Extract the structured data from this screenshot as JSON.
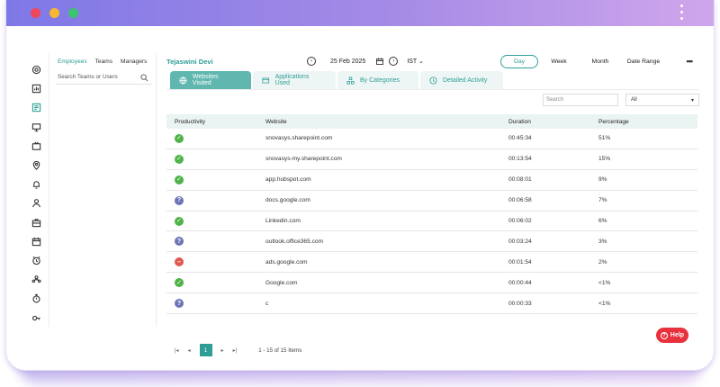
{
  "leftpanel": {
    "tabs": [
      "Employees",
      "Teams",
      "Managers"
    ],
    "search_placeholder": "Search Teams or Users"
  },
  "header": {
    "employee_name": "Tejaswini Devi",
    "date": "25 Feb 2025",
    "timezone": "IST",
    "range_tabs": [
      "Day",
      "Week",
      "Month",
      "Date Range"
    ],
    "more": "•••"
  },
  "tabs": [
    "Websites Visited",
    "Applications Used",
    "By Categories",
    "Detailed Activity"
  ],
  "filters": {
    "search_placeholder": "Search",
    "select_value": "All"
  },
  "table": {
    "headers": [
      "Productivity",
      "Website",
      "Duration",
      "Percentage"
    ],
    "rows": [
      {
        "status": "productive",
        "website": "snovasys.sharepoint.com",
        "duration": "00:45:34",
        "percentage": "51%"
      },
      {
        "status": "productive",
        "website": "snovasys-my.sharepoint.com",
        "duration": "00:13:54",
        "percentage": "15%"
      },
      {
        "status": "productive",
        "website": "app.hubspot.com",
        "duration": "00:08:01",
        "percentage": "9%"
      },
      {
        "status": "neutral",
        "website": "docs.google.com",
        "duration": "00:06:58",
        "percentage": "7%"
      },
      {
        "status": "productive",
        "website": "Linkedin.com",
        "duration": "00:06:02",
        "percentage": "6%"
      },
      {
        "status": "neutral",
        "website": "outlook.office365.com",
        "duration": "00:03:24",
        "percentage": "3%"
      },
      {
        "status": "unproductive",
        "website": "ads.google.com",
        "duration": "00:01:54",
        "percentage": "2%"
      },
      {
        "status": "productive",
        "website": "Google.com",
        "duration": "00:00:44",
        "percentage": "<1%"
      },
      {
        "status": "neutral",
        "website": "c",
        "duration": "00:00:33",
        "percentage": "<1%"
      }
    ]
  },
  "pager": {
    "current_page": "1",
    "info": "1 - 15 of 15 Items"
  },
  "help_label": "Help",
  "colors": {
    "accent": "#2d9d95",
    "productive": "#4fb34a",
    "neutral": "#6c74b6",
    "unproductive": "#e0594f",
    "help": "#e8313d"
  }
}
